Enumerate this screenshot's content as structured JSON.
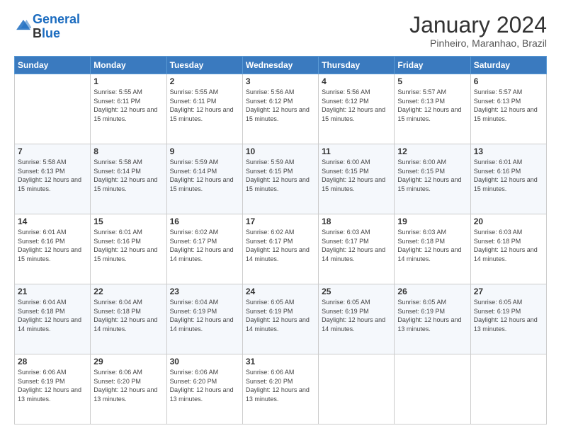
{
  "logo": {
    "line1": "General",
    "line2": "Blue"
  },
  "header": {
    "title": "January 2024",
    "location": "Pinheiro, Maranhao, Brazil"
  },
  "weekdays": [
    "Sunday",
    "Monday",
    "Tuesday",
    "Wednesday",
    "Thursday",
    "Friday",
    "Saturday"
  ],
  "weeks": [
    [
      {
        "day": "",
        "sunrise": "",
        "sunset": "",
        "daylight": ""
      },
      {
        "day": "1",
        "sunrise": "Sunrise: 5:55 AM",
        "sunset": "Sunset: 6:11 PM",
        "daylight": "Daylight: 12 hours and 15 minutes."
      },
      {
        "day": "2",
        "sunrise": "Sunrise: 5:55 AM",
        "sunset": "Sunset: 6:11 PM",
        "daylight": "Daylight: 12 hours and 15 minutes."
      },
      {
        "day": "3",
        "sunrise": "Sunrise: 5:56 AM",
        "sunset": "Sunset: 6:12 PM",
        "daylight": "Daylight: 12 hours and 15 minutes."
      },
      {
        "day": "4",
        "sunrise": "Sunrise: 5:56 AM",
        "sunset": "Sunset: 6:12 PM",
        "daylight": "Daylight: 12 hours and 15 minutes."
      },
      {
        "day": "5",
        "sunrise": "Sunrise: 5:57 AM",
        "sunset": "Sunset: 6:13 PM",
        "daylight": "Daylight: 12 hours and 15 minutes."
      },
      {
        "day": "6",
        "sunrise": "Sunrise: 5:57 AM",
        "sunset": "Sunset: 6:13 PM",
        "daylight": "Daylight: 12 hours and 15 minutes."
      }
    ],
    [
      {
        "day": "7",
        "sunrise": "Sunrise: 5:58 AM",
        "sunset": "Sunset: 6:13 PM",
        "daylight": "Daylight: 12 hours and 15 minutes."
      },
      {
        "day": "8",
        "sunrise": "Sunrise: 5:58 AM",
        "sunset": "Sunset: 6:14 PM",
        "daylight": "Daylight: 12 hours and 15 minutes."
      },
      {
        "day": "9",
        "sunrise": "Sunrise: 5:59 AM",
        "sunset": "Sunset: 6:14 PM",
        "daylight": "Daylight: 12 hours and 15 minutes."
      },
      {
        "day": "10",
        "sunrise": "Sunrise: 5:59 AM",
        "sunset": "Sunset: 6:15 PM",
        "daylight": "Daylight: 12 hours and 15 minutes."
      },
      {
        "day": "11",
        "sunrise": "Sunrise: 6:00 AM",
        "sunset": "Sunset: 6:15 PM",
        "daylight": "Daylight: 12 hours and 15 minutes."
      },
      {
        "day": "12",
        "sunrise": "Sunrise: 6:00 AM",
        "sunset": "Sunset: 6:15 PM",
        "daylight": "Daylight: 12 hours and 15 minutes."
      },
      {
        "day": "13",
        "sunrise": "Sunrise: 6:01 AM",
        "sunset": "Sunset: 6:16 PM",
        "daylight": "Daylight: 12 hours and 15 minutes."
      }
    ],
    [
      {
        "day": "14",
        "sunrise": "Sunrise: 6:01 AM",
        "sunset": "Sunset: 6:16 PM",
        "daylight": "Daylight: 12 hours and 15 minutes."
      },
      {
        "day": "15",
        "sunrise": "Sunrise: 6:01 AM",
        "sunset": "Sunset: 6:16 PM",
        "daylight": "Daylight: 12 hours and 15 minutes."
      },
      {
        "day": "16",
        "sunrise": "Sunrise: 6:02 AM",
        "sunset": "Sunset: 6:17 PM",
        "daylight": "Daylight: 12 hours and 14 minutes."
      },
      {
        "day": "17",
        "sunrise": "Sunrise: 6:02 AM",
        "sunset": "Sunset: 6:17 PM",
        "daylight": "Daylight: 12 hours and 14 minutes."
      },
      {
        "day": "18",
        "sunrise": "Sunrise: 6:03 AM",
        "sunset": "Sunset: 6:17 PM",
        "daylight": "Daylight: 12 hours and 14 minutes."
      },
      {
        "day": "19",
        "sunrise": "Sunrise: 6:03 AM",
        "sunset": "Sunset: 6:18 PM",
        "daylight": "Daylight: 12 hours and 14 minutes."
      },
      {
        "day": "20",
        "sunrise": "Sunrise: 6:03 AM",
        "sunset": "Sunset: 6:18 PM",
        "daylight": "Daylight: 12 hours and 14 minutes."
      }
    ],
    [
      {
        "day": "21",
        "sunrise": "Sunrise: 6:04 AM",
        "sunset": "Sunset: 6:18 PM",
        "daylight": "Daylight: 12 hours and 14 minutes."
      },
      {
        "day": "22",
        "sunrise": "Sunrise: 6:04 AM",
        "sunset": "Sunset: 6:18 PM",
        "daylight": "Daylight: 12 hours and 14 minutes."
      },
      {
        "day": "23",
        "sunrise": "Sunrise: 6:04 AM",
        "sunset": "Sunset: 6:19 PM",
        "daylight": "Daylight: 12 hours and 14 minutes."
      },
      {
        "day": "24",
        "sunrise": "Sunrise: 6:05 AM",
        "sunset": "Sunset: 6:19 PM",
        "daylight": "Daylight: 12 hours and 14 minutes."
      },
      {
        "day": "25",
        "sunrise": "Sunrise: 6:05 AM",
        "sunset": "Sunset: 6:19 PM",
        "daylight": "Daylight: 12 hours and 14 minutes."
      },
      {
        "day": "26",
        "sunrise": "Sunrise: 6:05 AM",
        "sunset": "Sunset: 6:19 PM",
        "daylight": "Daylight: 12 hours and 13 minutes."
      },
      {
        "day": "27",
        "sunrise": "Sunrise: 6:05 AM",
        "sunset": "Sunset: 6:19 PM",
        "daylight": "Daylight: 12 hours and 13 minutes."
      }
    ],
    [
      {
        "day": "28",
        "sunrise": "Sunrise: 6:06 AM",
        "sunset": "Sunset: 6:19 PM",
        "daylight": "Daylight: 12 hours and 13 minutes."
      },
      {
        "day": "29",
        "sunrise": "Sunrise: 6:06 AM",
        "sunset": "Sunset: 6:20 PM",
        "daylight": "Daylight: 12 hours and 13 minutes."
      },
      {
        "day": "30",
        "sunrise": "Sunrise: 6:06 AM",
        "sunset": "Sunset: 6:20 PM",
        "daylight": "Daylight: 12 hours and 13 minutes."
      },
      {
        "day": "31",
        "sunrise": "Sunrise: 6:06 AM",
        "sunset": "Sunset: 6:20 PM",
        "daylight": "Daylight: 12 hours and 13 minutes."
      },
      {
        "day": "",
        "sunrise": "",
        "sunset": "",
        "daylight": ""
      },
      {
        "day": "",
        "sunrise": "",
        "sunset": "",
        "daylight": ""
      },
      {
        "day": "",
        "sunrise": "",
        "sunset": "",
        "daylight": ""
      }
    ]
  ]
}
